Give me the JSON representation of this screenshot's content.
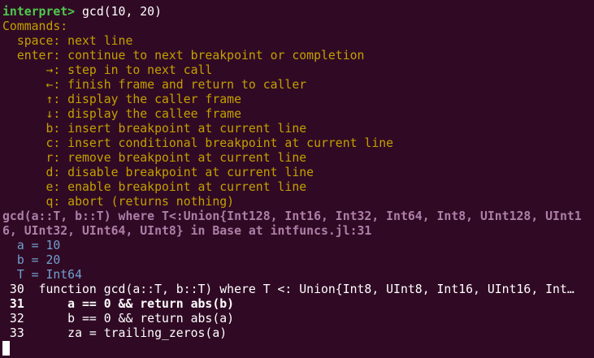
{
  "prompt": {
    "label": "interpret>",
    "input": " gcd(10, 20)"
  },
  "help": [
    "Commands:",
    "  space: next line",
    "  enter: continue to next breakpoint or completion",
    "      →: step in to next call",
    "      ←: finish frame and return to caller",
    "      ↑: display the caller frame",
    "      ↓: display the callee frame",
    "      b: insert breakpoint at current line",
    "      c: insert conditional breakpoint at current line",
    "      r: remove breakpoint at current line",
    "      d: disable breakpoint at current line",
    "      e: enable breakpoint at current line",
    "      q: abort (returns nothing)"
  ],
  "signature": [
    "gcd(a::T, b::T) where T<:Union{Int128, Int16, Int32, Int64, Int8, UInt128, UInt1",
    "6, UInt32, UInt64, UInt8} in Base at intfuncs.jl:31"
  ],
  "variables": [
    "  a = 10",
    "  b = 20",
    "  T = Int64"
  ],
  "code": [
    " 30  function gcd(a::T, b::T) where T <: Union{Int8, UInt8, Int16, UInt16, Int…",
    " 31      a == 0 && return abs(b)",
    " 32      b == 0 && return abs(a)",
    " 33      za = trailing_zeros(a)"
  ],
  "colors": {
    "background": "#300a24",
    "prompt": "#4ec94e",
    "help": "#c4a000",
    "signature": "#ad7fa8",
    "variables": "#729fcf",
    "code": "#ffffff"
  },
  "cursor_icon": "block-cursor"
}
